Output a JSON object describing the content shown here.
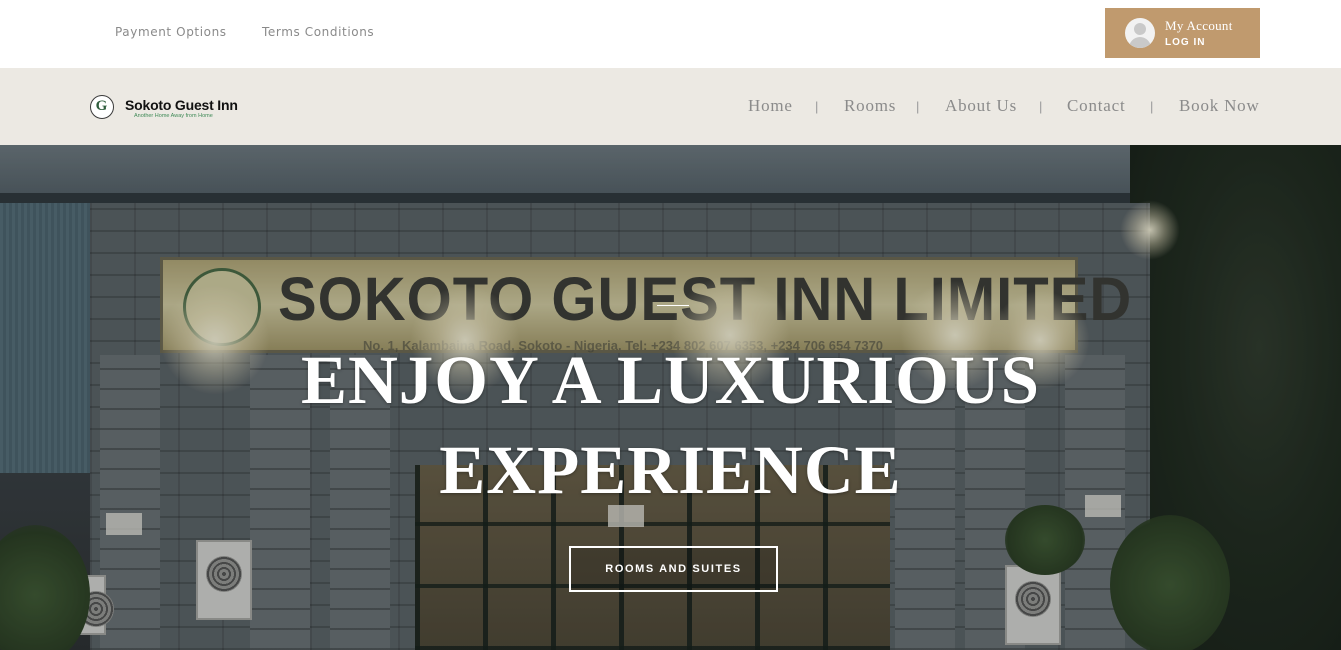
{
  "topbar": {
    "links": [
      "Payment Options",
      "Terms Conditions"
    ],
    "account": {
      "title": "My Account",
      "action": "LOG IN",
      "icon": "user-avatar-icon",
      "color": "#c09a6e"
    }
  },
  "brand": {
    "logo_letter": "G",
    "name": "Sokoto Guest Inn",
    "tagline": "Another Home Away from Home"
  },
  "nav": {
    "items": [
      "Home",
      "Rooms",
      "About Us",
      "Contact",
      "Book Now"
    ],
    "separator": "|",
    "background": "#ece9e3"
  },
  "hero": {
    "photo_sign_text": "SOKOTO GUEST INN LIMITED",
    "photo_sign_subtext": "No. 1, Kalambaina Road, Sokoto - Nigeria. Tel: +234 802 607 6353, +234 706 654 7370",
    "headline_line1": "ENJOY A LUXURIOUS",
    "headline_line2": "EXPERIENCE",
    "cta_label": "ROOMS AND SUITES"
  }
}
